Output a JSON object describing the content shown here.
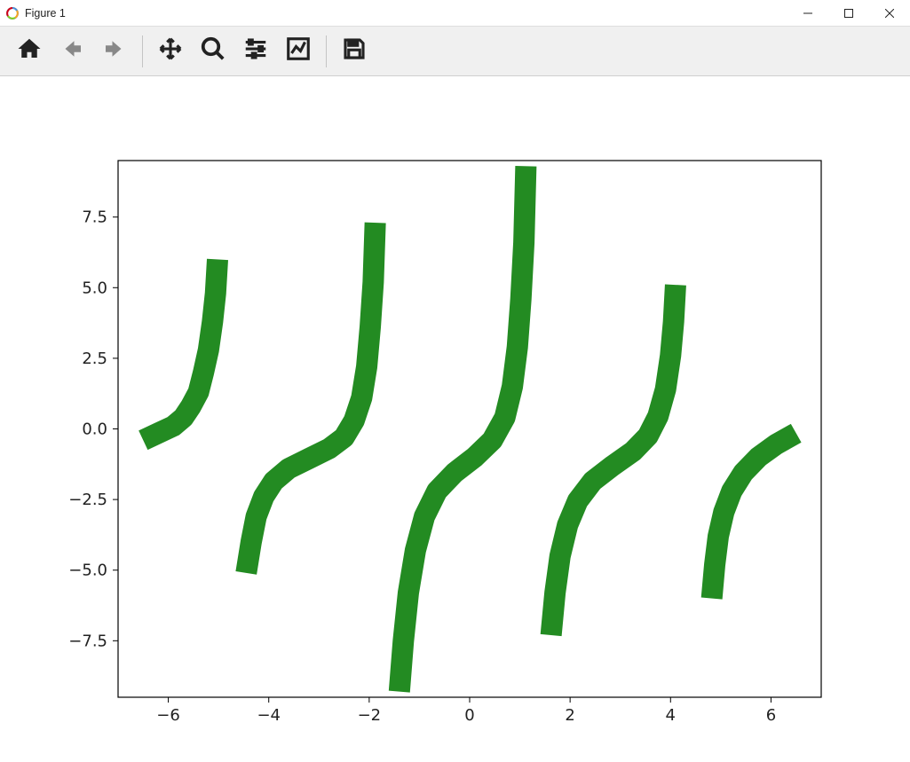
{
  "window": {
    "title": "Figure 1"
  },
  "toolbar": {
    "buttons": [
      {
        "name": "home-icon",
        "label": "Home"
      },
      {
        "name": "back-icon",
        "label": "Back"
      },
      {
        "name": "forward-icon",
        "label": "Forward"
      },
      {
        "name": "pan-icon",
        "label": "Pan"
      },
      {
        "name": "zoom-icon",
        "label": "Zoom"
      },
      {
        "name": "configure-icon",
        "label": "Configure subplots"
      },
      {
        "name": "axes-icon",
        "label": "Edit axes"
      },
      {
        "name": "save-icon",
        "label": "Save"
      }
    ]
  },
  "chart_data": {
    "type": "line",
    "title": "",
    "xlabel": "",
    "ylabel": "",
    "xlim": [
      -7.0,
      7.0
    ],
    "ylim": [
      -9.5,
      9.5
    ],
    "x_ticks": [
      -6,
      -4,
      -2,
      0,
      2,
      4,
      6
    ],
    "y_ticks": [
      -7.5,
      -5.0,
      -2.5,
      0.0,
      2.5,
      5.0,
      7.5
    ],
    "x_tick_labels": [
      "−6",
      "−4",
      "−2",
      "0",
      "2",
      "4",
      "6"
    ],
    "y_tick_labels": [
      "−7.5",
      "−5.0",
      "−2.5",
      "0.0",
      "2.5",
      "5.0",
      "7.5"
    ],
    "grid": false,
    "legend": false,
    "curve_color": "#238b22",
    "description": "Five thick green S-shaped / tangent-like curve segments rendered from a sampled 2D vector field",
    "series": [
      {
        "name": "curve-1",
        "points": [
          {
            "x": -6.5,
            "y": -0.4
          },
          {
            "x": -6.2,
            "y": -0.15
          },
          {
            "x": -5.9,
            "y": 0.1
          },
          {
            "x": -5.7,
            "y": 0.4
          },
          {
            "x": -5.55,
            "y": 0.8
          },
          {
            "x": -5.4,
            "y": 1.3
          },
          {
            "x": -5.3,
            "y": 2.0
          },
          {
            "x": -5.2,
            "y": 2.8
          },
          {
            "x": -5.12,
            "y": 3.8
          },
          {
            "x": -5.06,
            "y": 4.8
          },
          {
            "x": -5.02,
            "y": 6.0
          }
        ]
      },
      {
        "name": "curve-2",
        "points": [
          {
            "x": -4.45,
            "y": -5.1
          },
          {
            "x": -4.35,
            "y": -4.0
          },
          {
            "x": -4.25,
            "y": -3.1
          },
          {
            "x": -4.1,
            "y": -2.4
          },
          {
            "x": -3.9,
            "y": -1.85
          },
          {
            "x": -3.6,
            "y": -1.4
          },
          {
            "x": -3.2,
            "y": -1.05
          },
          {
            "x": -2.8,
            "y": -0.7
          },
          {
            "x": -2.5,
            "y": -0.3
          },
          {
            "x": -2.3,
            "y": 0.3
          },
          {
            "x": -2.15,
            "y": 1.1
          },
          {
            "x": -2.05,
            "y": 2.2
          },
          {
            "x": -1.98,
            "y": 3.6
          },
          {
            "x": -1.92,
            "y": 5.2
          },
          {
            "x": -1.88,
            "y": 7.3
          }
        ]
      },
      {
        "name": "curve-3",
        "points": [
          {
            "x": -1.4,
            "y": -9.3
          },
          {
            "x": -1.32,
            "y": -7.5
          },
          {
            "x": -1.22,
            "y": -5.8
          },
          {
            "x": -1.08,
            "y": -4.3
          },
          {
            "x": -0.9,
            "y": -3.1
          },
          {
            "x": -0.65,
            "y": -2.2
          },
          {
            "x": -0.3,
            "y": -1.55
          },
          {
            "x": 0.1,
            "y": -1.0
          },
          {
            "x": 0.45,
            "y": -0.4
          },
          {
            "x": 0.7,
            "y": 0.4
          },
          {
            "x": 0.85,
            "y": 1.5
          },
          {
            "x": 0.95,
            "y": 2.9
          },
          {
            "x": 1.02,
            "y": 4.6
          },
          {
            "x": 1.08,
            "y": 6.6
          },
          {
            "x": 1.12,
            "y": 9.3
          }
        ]
      },
      {
        "name": "curve-4",
        "points": [
          {
            "x": 1.62,
            "y": -7.3
          },
          {
            "x": 1.7,
            "y": -5.8
          },
          {
            "x": 1.8,
            "y": -4.5
          },
          {
            "x": 1.95,
            "y": -3.4
          },
          {
            "x": 2.15,
            "y": -2.55
          },
          {
            "x": 2.45,
            "y": -1.85
          },
          {
            "x": 2.85,
            "y": -1.3
          },
          {
            "x": 3.25,
            "y": -0.8
          },
          {
            "x": 3.55,
            "y": -0.25
          },
          {
            "x": 3.75,
            "y": 0.45
          },
          {
            "x": 3.9,
            "y": 1.4
          },
          {
            "x": 4.0,
            "y": 2.6
          },
          {
            "x": 4.06,
            "y": 3.8
          },
          {
            "x": 4.1,
            "y": 5.1
          }
        ]
      },
      {
        "name": "curve-5",
        "points": [
          {
            "x": 4.82,
            "y": -6.0
          },
          {
            "x": 4.88,
            "y": -4.8
          },
          {
            "x": 4.95,
            "y": -3.8
          },
          {
            "x": 5.06,
            "y": -2.95
          },
          {
            "x": 5.22,
            "y": -2.2
          },
          {
            "x": 5.45,
            "y": -1.55
          },
          {
            "x": 5.75,
            "y": -1.0
          },
          {
            "x": 6.1,
            "y": -0.55
          },
          {
            "x": 6.5,
            "y": -0.15
          }
        ]
      }
    ]
  }
}
